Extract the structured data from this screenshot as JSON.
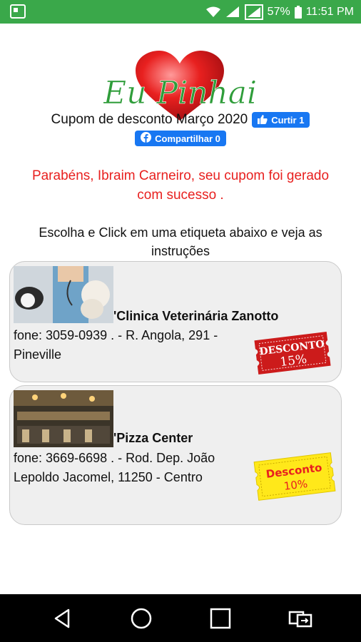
{
  "status_bar": {
    "battery": "57%",
    "time": "11:51 PM"
  },
  "logo": {
    "text": "Eu Pinhais"
  },
  "header": {
    "title": "Cupom de desconto Março 2020",
    "like_label": "Curtir 1",
    "share_label": "Compartilhar 0"
  },
  "success_message": "Parabéns, Ibraim Carneiro, seu cupom foi gerado com sucesso .",
  "instructions": "Escolha e Click em uma etiqueta abaixo e veja as instruções",
  "cards": [
    {
      "name": "'Clinica Veterinária Zanotto",
      "address": "fone: 3059-0939 . - R. Angola, 291 - Pineville",
      "coupon_line1": "DESCONTO",
      "coupon_line2": "15%",
      "coupon_color": "#cc1b1b"
    },
    {
      "name": "'Pizza Center",
      "address": "fone: 3669-6698 . - Rod. Dep. João Lepoldo Jacomel, 11250 - Centro",
      "coupon_line1": "Desconto",
      "coupon_line2": "10%",
      "coupon_color": "#ffe81a"
    }
  ],
  "colors": {
    "status_bar": "#3aa84a",
    "facebook": "#1877f2",
    "success_text": "#e8201f"
  }
}
